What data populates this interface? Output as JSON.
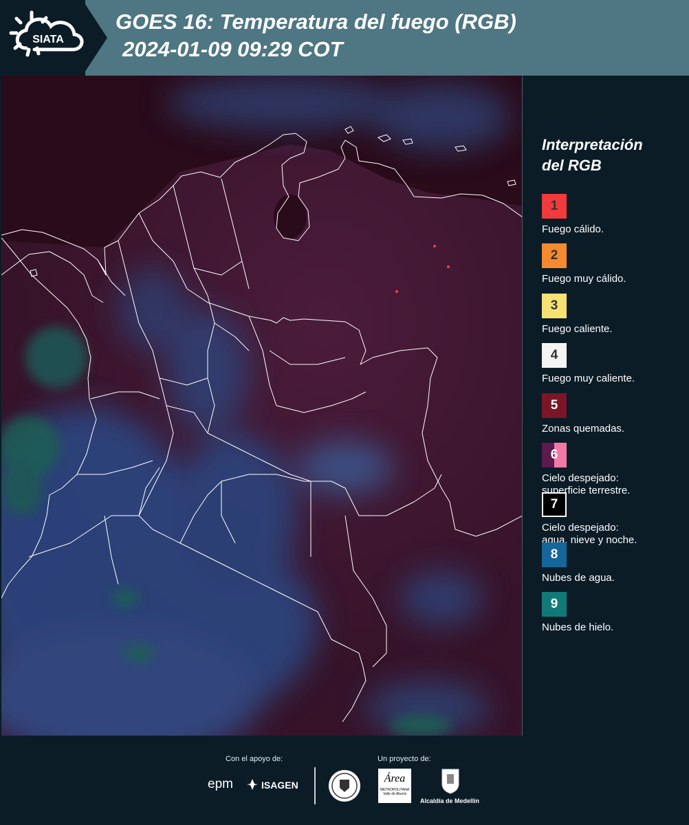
{
  "header": {
    "logo_text": "SIATA",
    "title_line1": "GOES 16: Temperatura del fuego (RGB)",
    "title_line2": "2024-01-09 09:29 COT"
  },
  "legend": {
    "title_line1": "Interpretación",
    "title_line2": "del RGB",
    "items": [
      {
        "number": "1",
        "color": "#f03a3c",
        "label1": "Fuego cálido.",
        "label2": ""
      },
      {
        "number": "2",
        "color": "#f58a2f",
        "label1": "Fuego muy cálido.",
        "label2": ""
      },
      {
        "number": "3",
        "color": "#f6e272",
        "label1": "Fuego caliente.",
        "label2": ""
      },
      {
        "number": "4",
        "color": "#f4f4f4",
        "label1": "Fuego muy caliente.",
        "label2": ""
      },
      {
        "number": "5",
        "color": "#7b1628",
        "label1": "Zonas quemadas.",
        "label2": ""
      },
      {
        "number": "6",
        "color": "#5c1a4f",
        "color2": "#f07aa5",
        "label1": "Cielo despejado:",
        "label2": "superficie terrestre."
      },
      {
        "number": "7",
        "color": "#000000",
        "label1": "Cielo despejado:",
        "label2": "agua, nieve y noche."
      },
      {
        "number": "8",
        "color": "#15669b",
        "label1": "Nubes de agua.",
        "label2": ""
      },
      {
        "number": "9",
        "color": "#0f7a78",
        "label1": "Nubes de hielo.",
        "label2": ""
      }
    ]
  },
  "footer": {
    "support_label": "Con el apoyo de:",
    "project_label": "Un proyecto de:",
    "sponsor1": "epm",
    "sponsor2": "ISAGEN",
    "partner3_line1": "Área",
    "partner3_line2": "METROPOLITANA",
    "partner3_line3": "Valle de Aburrá",
    "partner4": "Alcaldía de Medellín"
  }
}
